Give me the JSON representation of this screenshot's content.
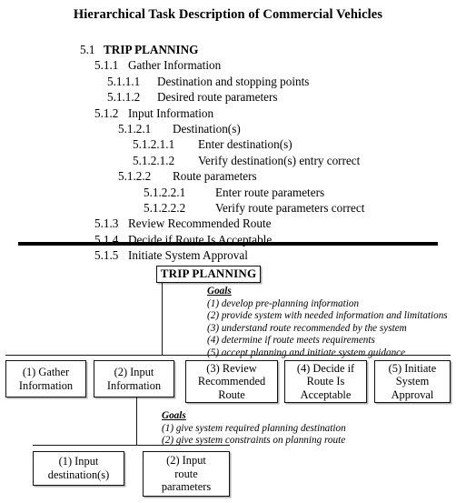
{
  "page": {
    "title": "Hierarchical Task Description of Commercial Vehicles"
  },
  "outline": {
    "items": [
      {
        "level": 1,
        "number": "5.1",
        "text": "TRIP PLANNING"
      },
      {
        "level": 2,
        "number": "5.1.1",
        "text": "Gather Information"
      },
      {
        "level": 3,
        "number": "5.1.1.1",
        "text": "Destination and stopping points"
      },
      {
        "level": 3,
        "number": "5.1.1.2",
        "text": "Desired route parameters"
      },
      {
        "level": 2,
        "number": "5.1.2",
        "text": "Input Information"
      },
      {
        "level": 4,
        "number": "5.1.2.1",
        "text": "Destination(s)"
      },
      {
        "level": 5,
        "number": "5.1.2.1.1",
        "text": "Enter destination(s)"
      },
      {
        "level": 5,
        "number": "5.1.2.1.2",
        "text": "Verify destination(s) entry correct"
      },
      {
        "level": 4,
        "number": "5.1.2.2",
        "text": "Route parameters"
      },
      {
        "level": 6,
        "number": "5.1.2.2.1",
        "text": "Enter route parameters"
      },
      {
        "level": 6,
        "number": "5.1.2.2.2",
        "text": "Verify route parameters correct"
      },
      {
        "level": 2,
        "number": "5.1.3",
        "text": "Review Recommended Route"
      },
      {
        "level": 2,
        "number": "5.1.4",
        "text": "Decide if Route Is Acceptable"
      },
      {
        "level": 2,
        "number": "5.1.5",
        "text": "Initiate System Approval"
      }
    ]
  },
  "diagram": {
    "root": {
      "label": "TRIP PLANNING",
      "goals_title": "Goals",
      "goals": [
        "(1) develop pre-planning information",
        "(2) provide system with needed information and limitations",
        "(3) understand route recommended by the system",
        "(4) determine if route meets requirements",
        "(5) accept planning and initiate system guidance"
      ]
    },
    "tier1": [
      {
        "label": "(1) Gather\nInformation"
      },
      {
        "label": "(2) Input\nInformation"
      },
      {
        "label": "(3) Review\nRecommended\nRoute"
      },
      {
        "label": "(4) Decide if\nRoute Is\nAcceptable"
      },
      {
        "label": "(5) Initiate\nSystem\nApproval"
      }
    ],
    "input_node": {
      "goals_title": "Goals",
      "goals": [
        "(1) give system required planning destination",
        "(2) give system constraints on planning route"
      ]
    },
    "tier2": [
      {
        "label": "(1) Input\ndestination(s)"
      },
      {
        "label": "(2) Input\nroute\nparameters"
      }
    ]
  }
}
